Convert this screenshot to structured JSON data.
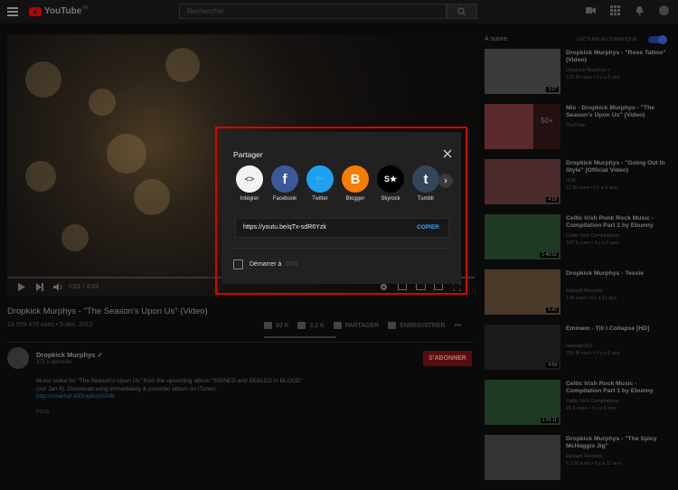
{
  "header": {
    "logo_text": "YouTube",
    "logo_sup": "FR",
    "search_placeholder": "Rechercher"
  },
  "player": {
    "time": "0:01 / 4:03"
  },
  "video": {
    "title": "Dropkick Murphys - \"The Season's Upon Us\" (Video)",
    "views": "14 559 479 vues • 5 déc. 2012",
    "likes": "92 K",
    "dislikes": "3,2 K",
    "share_label": "PARTAGER",
    "save_label": "ENREGISTRER",
    "more": "•••"
  },
  "channel": {
    "name": "Dropkick Murphys ✓",
    "subs": "372 k abonnés",
    "subscribe": "S'ABONNER"
  },
  "description": {
    "line1": "Music video for \"The Season's Upon Us\" from the upcoming album \"SIGNED and SEALED in BLOOD\"",
    "line2": "(out Jan 8). Download song immediately & preorder album on iTunes:",
    "link": "http://smarturl.it/DropkickSAIB",
    "more": "PLUS"
  },
  "sidebar": {
    "header": "À suivre",
    "autoplay": "LECTURE AUTOMATIQUE",
    "items": [
      {
        "title": "Dropkick Murphys - \"Rose Tattoo\" (Video)",
        "channel": "Dropkick Murphys ✓",
        "views": "129 M vues • il y a 8 ans",
        "duration": "3:27",
        "thumb": "#3a3a3a"
      },
      {
        "title": "Mix - Dropkick Murphys - \"The Season's Upon Us\" (Video)",
        "channel": "YouTube",
        "views": "",
        "duration": "",
        "thumb": "#5a2a2a",
        "mix": "50+"
      },
      {
        "title": "Dropkick Murphys - \"Going Out In Style\" (Official Video)",
        "channel": "nGK",
        "views": "13 M vues • il y a 8 ans",
        "duration": "4:18",
        "thumb": "#4a2a2a"
      },
      {
        "title": "Celtic Irish Punk Rock Music - Compilation Part 2 by Ebunny",
        "channel": "Celtic Irish Compilations",
        "views": "167 k vues • il y a 6 ans",
        "duration": "1:40:52",
        "thumb": "#1e3a22"
      },
      {
        "title": "Dropkick Murphys - Tessie",
        "channel": "Epitaph Records",
        "views": "1 M vues • il y a 11 ans",
        "duration": "5:42",
        "thumb": "#4a3a2a"
      },
      {
        "title": "Eminem - Till I Collapse [HD]",
        "channel": "marioged23",
        "views": "250 M vues • il y a 6 ans",
        "duration": "4:59",
        "thumb": "#1a1a1a"
      },
      {
        "title": "Celtic Irish Rock Music - Compilation Part 1 by Ebunny",
        "channel": "Celtic Irish Compilations",
        "views": "43 k vues • il y a 6 ans",
        "duration": "1:20:11",
        "thumb": "#1e3a22"
      },
      {
        "title": "Dropkick Murphys - \"The Spicy McHaggis Jig\"",
        "channel": "Epitaph Records",
        "views": "6,1 M vues • il y a 11 ans",
        "duration": "",
        "thumb": "#333"
      }
    ]
  },
  "share_dialog": {
    "title": "Partager",
    "buttons": [
      {
        "label": "Intégrer",
        "color": "#f2f2f2",
        "glyph": "<>",
        "icon": "embed-icon"
      },
      {
        "label": "Facebook",
        "color": "#3b5998",
        "glyph": "f",
        "icon": "facebook-icon"
      },
      {
        "label": "Twitter",
        "color": "#1da1f2",
        "glyph": "🐦",
        "icon": "twitter-icon"
      },
      {
        "label": "Blogger",
        "color": "#f57d00",
        "glyph": "B",
        "icon": "blogger-icon"
      },
      {
        "label": "Skyrock",
        "color": "#000000",
        "glyph": "S★",
        "icon": "skyrock-icon"
      },
      {
        "label": "Tumblr",
        "color": "#35465c",
        "glyph": "t",
        "icon": "tumblr-icon"
      }
    ],
    "url": "https://youtu.be/qTx-sdR6Yzk",
    "copy_label": "COPIER",
    "start_label": "Démarrer à",
    "start_time": "0:01"
  },
  "colors": {
    "highlight": "#dd0000",
    "link": "#3ea6ff"
  }
}
